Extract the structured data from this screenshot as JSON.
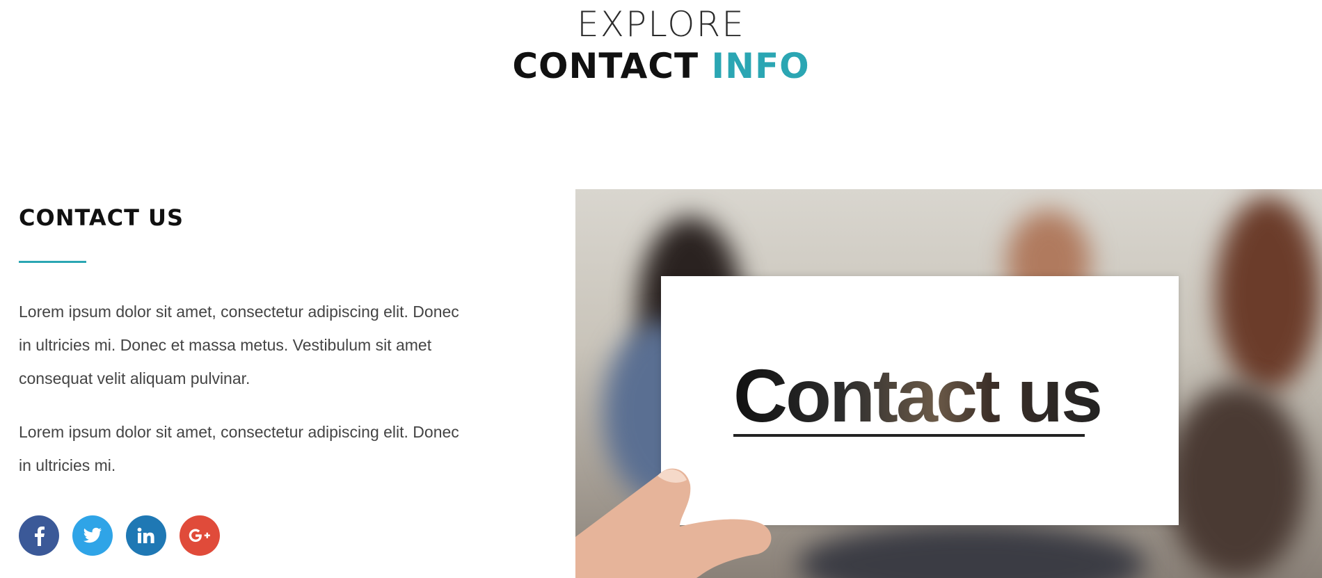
{
  "header": {
    "kicker": "EXPLORE",
    "title_main": "CONTACT",
    "title_accent": "INFO"
  },
  "contact": {
    "heading": "CONTACT US",
    "paragraph1": "Lorem ipsum dolor sit amet, consectetur adipiscing elit. Donec in ultricies mi. Donec et massa metus. Vestibulum sit amet consequat velit aliquam pulvinar.",
    "paragraph2": "Lorem ipsum dolor sit amet, consectetur adipiscing elit. Donec in ultricies mi."
  },
  "social": [
    {
      "name": "facebook-icon",
      "glyph": "f",
      "color": "#3b5998"
    },
    {
      "name": "twitter-icon",
      "glyph": "twitter",
      "color": "#2fa4e7"
    },
    {
      "name": "linkedin-icon",
      "glyph": "in",
      "color": "#1f78b4"
    },
    {
      "name": "google-plus-icon",
      "glyph": "G+",
      "color": "#e04b3a"
    }
  ],
  "image": {
    "card_text": "Contact us"
  },
  "colors": {
    "accent": "#2ba6b3",
    "heading": "#111111",
    "body_text": "#444444"
  }
}
